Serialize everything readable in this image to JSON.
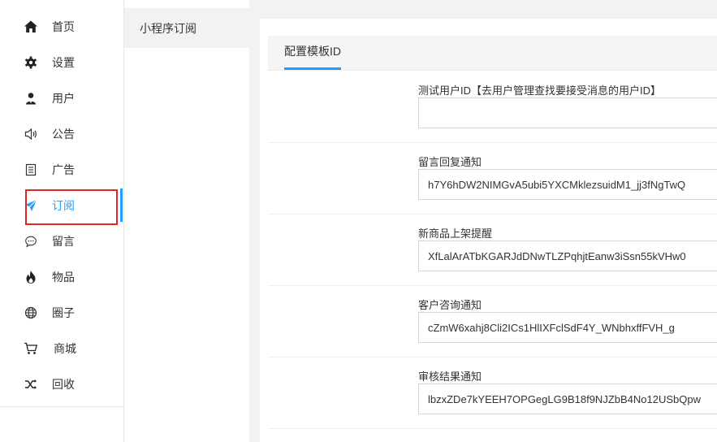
{
  "sidebar": {
    "items": [
      {
        "label": "首页",
        "icon": "home-icon"
      },
      {
        "label": "设置",
        "icon": "gear-icon"
      },
      {
        "label": "用户",
        "icon": "user-icon"
      },
      {
        "label": "公告",
        "icon": "speaker-icon"
      },
      {
        "label": "广告",
        "icon": "document-icon"
      },
      {
        "label": "订阅",
        "icon": "paper-plane-icon",
        "active": true
      },
      {
        "label": "留言",
        "icon": "chat-bubble-icon"
      },
      {
        "label": "物品",
        "icon": "fire-icon"
      },
      {
        "label": "圈子",
        "icon": "globe-icon"
      },
      {
        "label": "商城",
        "icon": "cart-icon"
      },
      {
        "label": "回收",
        "icon": "shuffle-icon"
      }
    ]
  },
  "subnav": {
    "items": [
      {
        "label": "小程序订阅"
      }
    ]
  },
  "main": {
    "tab": "配置模板ID",
    "fields": [
      {
        "label": "测试用户ID【去用户管理查找要接受消息的用户ID】",
        "value": ""
      },
      {
        "label": "留言回复通知",
        "value": "h7Y6hDW2NIMGvA5ubi5YXCMklezsuidM1_jj3fNgTwQ"
      },
      {
        "label": "新商品上架提醒",
        "value": "XfLalArATbKGARJdDNwTLZPqhjtEanw3iSsn55kVHw0"
      },
      {
        "label": "客户咨询通知",
        "value": "cZmW6xahj8Cli2ICs1HlIXFclSdF4Y_WNbhxffFVH_g"
      },
      {
        "label": "审核结果通知",
        "value": "lbzxZDe7kYEEH7OPGegLG9B18f9NJZbB4No12USbQpw"
      }
    ]
  },
  "colors": {
    "accent": "#1e9fff",
    "highlight_box": "#e0262a",
    "background": "#f2f2f2"
  }
}
